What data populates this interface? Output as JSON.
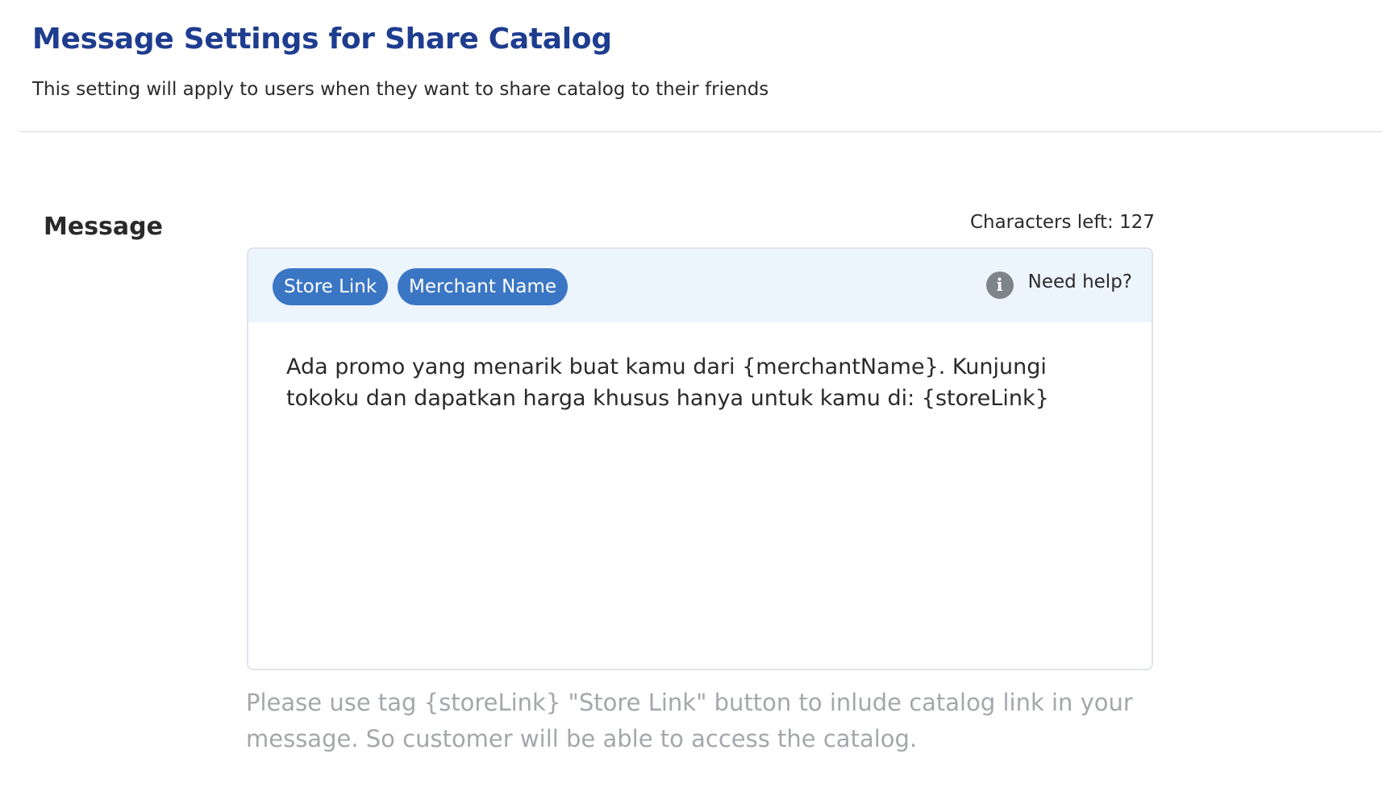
{
  "header": {
    "title": "Message Settings for Share Catalog",
    "subtitle": "This setting will apply to users when they want to share catalog to their friends"
  },
  "message_field": {
    "label": "Message",
    "characters_left": "Characters left: 127",
    "toolbar": {
      "tags": [
        {
          "label": "Store Link"
        },
        {
          "label": "Merchant Name"
        }
      ],
      "help": {
        "icon": "info-icon",
        "label": "Need help?"
      }
    },
    "value": "Ada promo yang menarik buat kamu dari {merchantName}. Kunjungi tokoku dan dapatkan harga khusus hanya untuk kamu di: {storeLink}",
    "hint": "Please use tag {storeLink} \"Store Link\" button to inlude catalog link in your message. So customer will be able to access the catalog."
  },
  "colors": {
    "title": "#1f3d8f",
    "tag_button": "#3b76c4",
    "toolbar_bg": "#ecf4fd",
    "hint_text": "#a4a7ab"
  }
}
